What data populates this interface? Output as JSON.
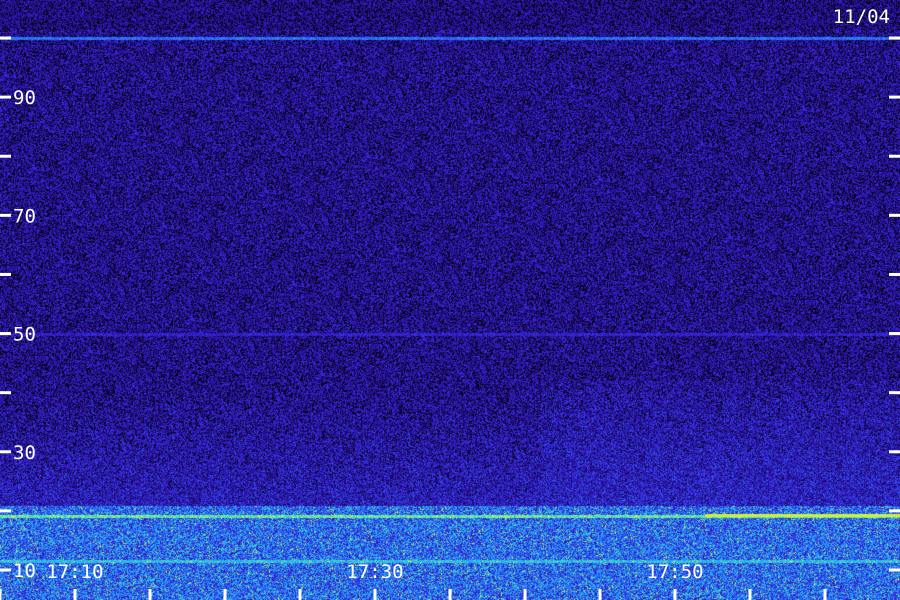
{
  "chart_data": {
    "type": "heatmap",
    "title": "",
    "date_label": "11/04",
    "xlabel": "",
    "ylabel": "",
    "y_ticks": [
      10,
      20,
      30,
      40,
      50,
      60,
      70,
      80,
      90,
      100
    ],
    "y_tick_labels": [
      {
        "value": 10,
        "label": "10"
      },
      {
        "value": 30,
        "label": "30"
      },
      {
        "value": 50,
        "label": "50"
      },
      {
        "value": 70,
        "label": "70"
      },
      {
        "value": 90,
        "label": "90"
      }
    ],
    "ylim": [
      10,
      100
    ],
    "x_ticks_minutes": [
      17.083,
      17.167,
      17.25,
      17.333,
      17.417,
      17.5,
      17.583,
      17.667,
      17.75,
      17.833,
      17.917,
      18.0
    ],
    "x_tick_labels": [
      {
        "value": "17:10",
        "label": "17:10"
      },
      {
        "value": "17:30",
        "label": "17:30"
      },
      {
        "value": "17:50",
        "label": "17:50"
      }
    ],
    "xlim": [
      "17:05",
      "18:05"
    ],
    "colormap": [
      "#000000",
      "#1a0a6e",
      "#3a1fd8",
      "#2a6cff",
      "#20c8e8",
      "#b0ff60",
      "#ffe000"
    ],
    "features": [
      {
        "name": "",
        "kind": "horizontal-line",
        "y": 100,
        "intensity": 0.55
      },
      {
        "name": "",
        "kind": "horizontal-line",
        "y": 50,
        "intensity": 0.35
      },
      {
        "name": "",
        "kind": "horizontal-line",
        "y": 19.2,
        "intensity": 0.8
      },
      {
        "name": "",
        "kind": "horizontal-line",
        "y": 11.5,
        "intensity": 0.7
      },
      {
        "name": "",
        "kind": "segment",
        "y": 19.3,
        "x_start": "17:52",
        "x_end": "18:05",
        "intensity": 0.95
      }
    ],
    "grid": false,
    "legend": "none"
  }
}
